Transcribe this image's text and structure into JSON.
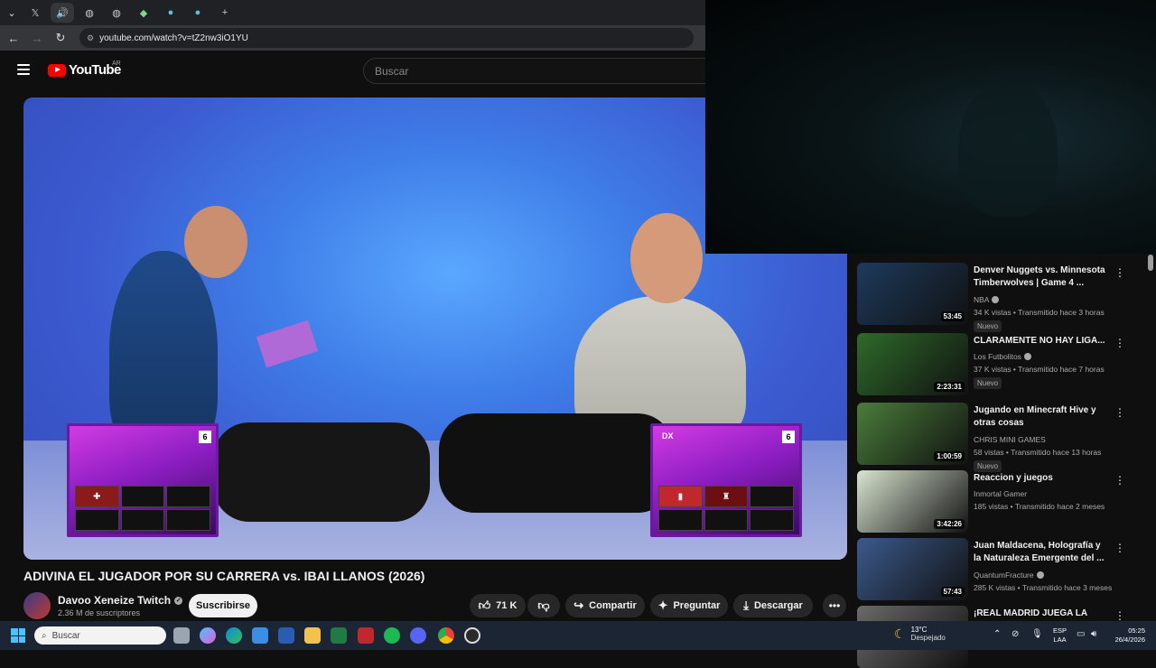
{
  "browser": {
    "tabs": [
      "chevron-down",
      "x",
      "audio",
      "tab",
      "tab",
      "tab",
      "tab",
      "tab"
    ],
    "new_tab": "+",
    "url": "youtube.com/watch?v=tZ2nw3iO1YU"
  },
  "youtube": {
    "logo_text": "YouTube",
    "country": "AR",
    "search_placeholder": "Buscar"
  },
  "video": {
    "title": "ADIVINA EL JUGADOR POR SU CARRERA vs. IBAI LLANOS (2026)",
    "left_panel": {
      "score": "6"
    },
    "right_panel": {
      "tag": "DX",
      "score": "6"
    }
  },
  "channel": {
    "name": "Davoo Xeneize Twitch",
    "subscribers": "2.36 M de suscriptores",
    "subscribe_label": "Suscribirse"
  },
  "actions": {
    "likes": "71 K",
    "share": "Compartir",
    "ask": "Preguntar",
    "download": "Descargar"
  },
  "recommendations": [
    {
      "title": "Denver Nuggets vs. Minnesota Timberwolves | Game 4 ...",
      "channel": "NBA",
      "verified": true,
      "meta": "34 K vistas • Transmitido hace 3 horas",
      "duration": "53:45",
      "badge": "Nuevo",
      "thumb_color": "#1d3a5c"
    },
    {
      "title": "CLARAMENTE NO HAY LIGA...",
      "channel": "Los Futbolitos",
      "verified": true,
      "meta": "37 K vistas • Transmitido hace 7 horas",
      "duration": "2:23:31",
      "badge": "Nuevo",
      "thumb_color": "#2e6b2a"
    },
    {
      "title": "Jugando en Minecraft Hive y otras cosas",
      "channel": "CHRIS MINI GAMES",
      "verified": false,
      "meta": "58 vistas • Transmitido hace 13 horas",
      "duration": "1:00:59",
      "badge": "Nuevo",
      "thumb_color": "#4a7d3a"
    },
    {
      "title": "Reaccion y juegos",
      "channel": "Inmortal Gamer",
      "verified": false,
      "meta": "185 vistas • Transmitido hace 2 meses",
      "duration": "3:42:26",
      "badge": "",
      "thumb_color": "#d8e4d0"
    },
    {
      "title": "Juan Maldacena, Holografía y la Naturaleza Emergente del ...",
      "channel": "QuantumFracture",
      "verified": true,
      "meta": "285 K vistas • Transmitido hace 3 meses",
      "duration": "57:43",
      "badge": "",
      "thumb_color": "#3b5a8c"
    },
    {
      "title": "¡REAL MADRID JUEGA LA",
      "channel": "",
      "verified": false,
      "meta": "",
      "duration": "",
      "badge": "",
      "thumb_color": "#6a6a6a"
    }
  ],
  "taskbar": {
    "search_placeholder": "Buscar",
    "temperature": "13°C",
    "weather": "Despejado",
    "lang1": "ESP",
    "lang2": "LAA",
    "time": "05:25",
    "date": "26/4/2026"
  }
}
